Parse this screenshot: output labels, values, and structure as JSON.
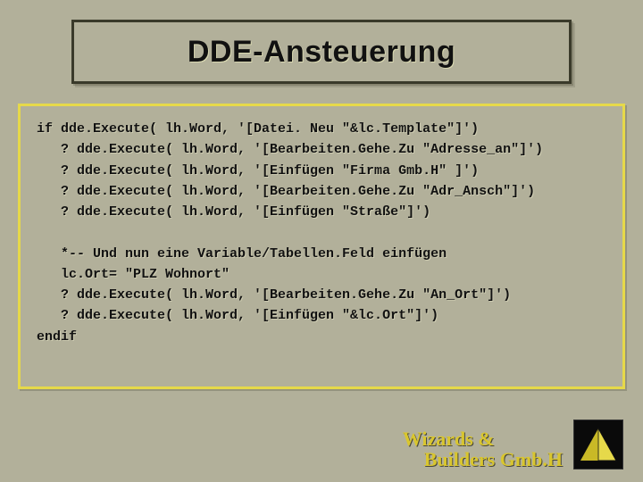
{
  "title": "DDE-Ansteuerung",
  "code_lines": [
    "if dde.Execute( lh.Word, '[Datei. Neu \"&lc.Template\"]')",
    "   ? dde.Execute( lh.Word, '[Bearbeiten.Gehe.Zu \"Adresse_an\"]')",
    "   ? dde.Execute( lh.Word, '[Einfügen \"Firma Gmb.H\" ]')",
    "   ? dde.Execute( lh.Word, '[Bearbeiten.Gehe.Zu \"Adr_Ansch\"]')",
    "   ? dde.Execute( lh.Word, '[Einfügen \"Straße\"]')",
    "",
    "   *-- Und nun eine Variable/Tabellen.Feld einfügen",
    "   lc.Ort= \"PLZ Wohnort\"",
    "   ? dde.Execute( lh.Word, '[Bearbeiten.Gehe.Zu \"An_Ort\"]')",
    "   ? dde.Execute( lh.Word, '[Einfügen \"&lc.Ort\"]')",
    "endif"
  ],
  "footer": {
    "line1": "Wizards &",
    "line2": "Builders Gmb.H"
  }
}
